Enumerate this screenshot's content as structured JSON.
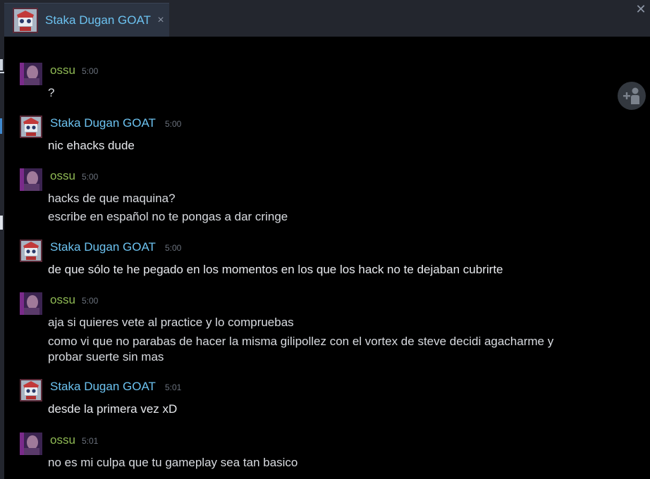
{
  "window": {
    "tab_title": "Staka Dugan GOAT",
    "tab_close": "×",
    "close_glyph": "✕"
  },
  "colors": {
    "ossu_name": "#8fb954",
    "staka_name": "#6cc2f0",
    "timestamp": "#6a717c",
    "message_text": "#d8dbe0",
    "chat_background": "#000000"
  },
  "messages": [
    {
      "author": "ossu",
      "time": "5:00",
      "lines": [
        "?"
      ]
    },
    {
      "author": "Staka Dugan GOAT",
      "time": "5:00",
      "lines": [
        "nic ehacks dude"
      ]
    },
    {
      "author": "ossu",
      "time": "5:00",
      "lines": [
        "hacks de que maquina?",
        "escribe en español no te pongas a dar cringe"
      ]
    },
    {
      "author": "Staka Dugan GOAT",
      "time": "5:00",
      "lines": [
        "de que sólo te he pegado en los momentos en los que los hack no te dejaban cubrirte"
      ]
    },
    {
      "author": "ossu",
      "time": "5:00",
      "lines": [
        "aja si quieres vete al practice y lo compruebas",
        "como vi que no parabas de hacer la misma gilipollez con el vortex de steve decidi agacharme y",
        "probar suerte sin mas"
      ]
    },
    {
      "author": "Staka Dugan GOAT",
      "time": "5:01",
      "lines": [
        "desde la primera vez xD"
      ]
    },
    {
      "author": "ossu",
      "time": "5:01",
      "lines": [
        "no es mi culpa que tu gameplay sea tan basico"
      ]
    }
  ],
  "icons": {
    "add_friend": "add-friend-icon",
    "ossu_avatar": "purple-portrait-avatar",
    "staka_avatar": "robot-mascot-avatar"
  }
}
